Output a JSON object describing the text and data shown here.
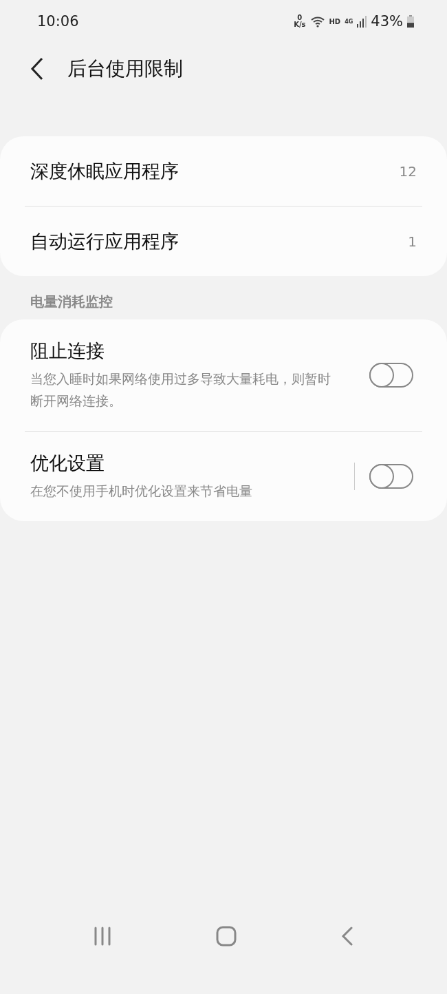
{
  "status_bar": {
    "time": "10:06",
    "speed_value": "0",
    "speed_unit": "K/s",
    "hd": "HD",
    "network": "4G",
    "battery": "43%"
  },
  "header": {
    "title": "后台使用限制"
  },
  "app_lists": [
    {
      "label": "深度休眠应用程序",
      "count": "12"
    },
    {
      "label": "自动运行应用程序",
      "count": "1"
    }
  ],
  "section": {
    "title": "电量消耗监控",
    "items": [
      {
        "title": "阻止连接",
        "description": "当您入睡时如果网络使用过多导致大量耗电，则暂时断开网络连接。",
        "on": false,
        "divider": false
      },
      {
        "title": "优化设置",
        "description": "在您不使用手机时优化设置来节省电量",
        "on": false,
        "divider": true
      }
    ]
  }
}
